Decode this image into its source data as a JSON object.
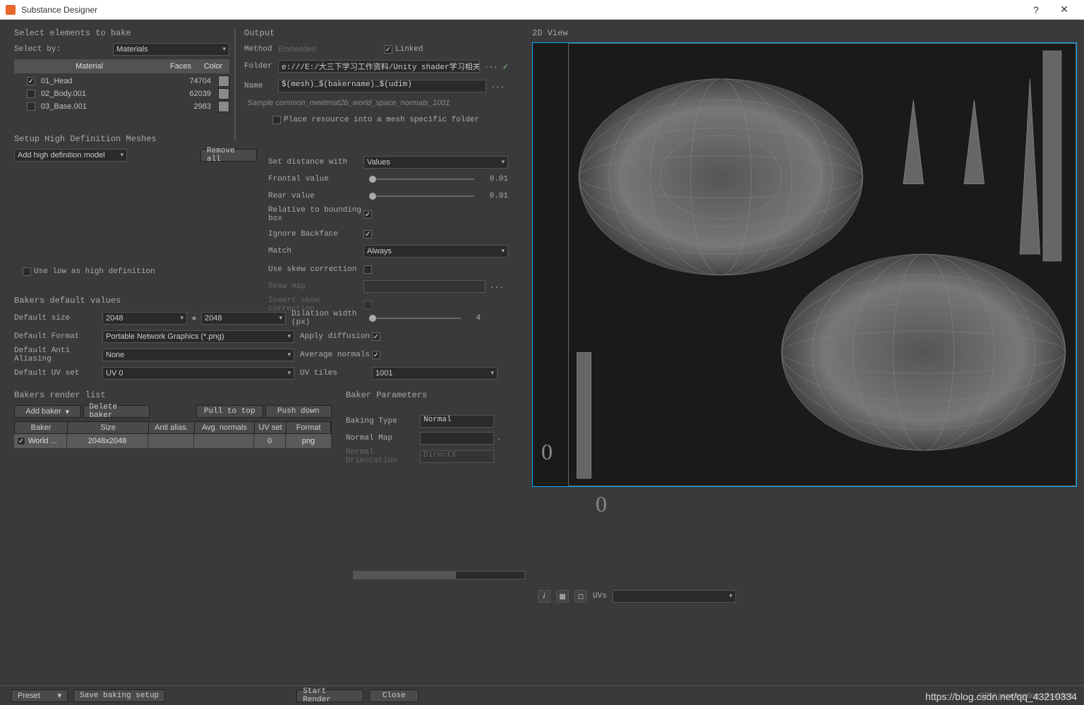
{
  "window": {
    "title": "Substance Designer"
  },
  "leftPanel": {
    "selectElements": {
      "title": "Select elements to bake",
      "selectByLabel": "Select by:",
      "selectByValue": "Materials",
      "materialTab": "Material",
      "facesTab": "Faces",
      "colorTab": "Color",
      "items": [
        {
          "checked": true,
          "name": "01_Head",
          "faces": "74704"
        },
        {
          "checked": false,
          "name": "02_Body.001",
          "faces": "62039"
        },
        {
          "checked": false,
          "name": "03_Base.001",
          "faces": "2983"
        }
      ]
    },
    "output": {
      "title": "Output",
      "methodLabel": "Method",
      "methodValue": "Embedded",
      "linkedLabel": "Linked",
      "folderLabel": "Folder",
      "folderValue": "e:///E:/大三下学习工作资料/Unity shader学习相关/SD",
      "nameLabel": "Name",
      "nameValue": "$(mesh)_$(bakername)_$(udim)",
      "sample": "Sample common_meetmat2b_world_space_normals_1001",
      "placeResource": "Place resource into a mesh specific folder"
    },
    "hdMeshes": {
      "title": "Setup High Definition Meshes",
      "addBtn": "Add high definition model",
      "removeBtn": "Remove all",
      "useLowAsHigh": "Use low as high definition"
    },
    "distance": {
      "setDistanceLabel": "Set distance with",
      "setDistanceValue": "Values",
      "frontalLabel": "Frontal value",
      "frontalValue": "0.01",
      "rearLabel": "Rear value",
      "rearValue": "0.01",
      "relativeLabel": "Relative to bounding box",
      "ignoreBackfaceLabel": "Ignore Backface",
      "matchLabel": "Match",
      "matchValue": "Always",
      "useSkewLabel": "Use skew correction",
      "skewMapLabel": "Skew map",
      "invertSkewLabel": "Invert skew correction"
    },
    "defaults": {
      "title": "Bakers default values",
      "sizeLabel": "Default size",
      "sizeW": "2048",
      "sizeH": "2048",
      "dilationLabel": "Dilation width (px)",
      "dilationValue": "4",
      "formatLabel": "Default Format",
      "formatValue": "Portable Network Graphics (*.png)",
      "applyDiffusionLabel": "Apply diffusion",
      "aaLabel": "Default Anti Aliasing",
      "aaValue": "None",
      "avgNormalsLabel": "Average normals",
      "uvSetLabel": "Default UV set",
      "uvSetValue": "UV 0",
      "uvTilesLabel": "UV tiles",
      "uvTilesValue": "1001"
    },
    "renderList": {
      "title": "Bakers render list",
      "addBakerBtn": "Add baker",
      "deleteBakerBtn": "Delete baker",
      "pullTopBtn": "Pull to top",
      "pushDownBtn": "Push down",
      "headers": {
        "baker": "Baker",
        "size": "Size",
        "aa": "Anti alias.",
        "avg": "Avg. normals",
        "uv": "UV set",
        "fmt": "Format"
      },
      "row": {
        "baker": "World ...",
        "size": "2048x2048",
        "aa": "",
        "avg": "",
        "uv": "0",
        "fmt": "png"
      }
    },
    "bakerParams": {
      "title": "Baker Parameters",
      "bakingTypeLabel": "Baking Type",
      "bakingTypeValue": "Normal",
      "normalMapLabel": "Normal Map",
      "normalOrientLabel": "Normal Orientation",
      "normalOrientValue": "DirectX"
    }
  },
  "rightPanel": {
    "title": "2D View",
    "axisY": "0",
    "axisX": "0",
    "uvsLabel": "UVs"
  },
  "footer": {
    "presetBtn": "Preset",
    "saveBtn": "Save baking setup",
    "startBtn": "Start Render",
    "closeBtn": "Close",
    "gpuText": "GPU acceleration: disabled",
    "watermark": "https://blog.csdn.net/qq_43210334"
  }
}
